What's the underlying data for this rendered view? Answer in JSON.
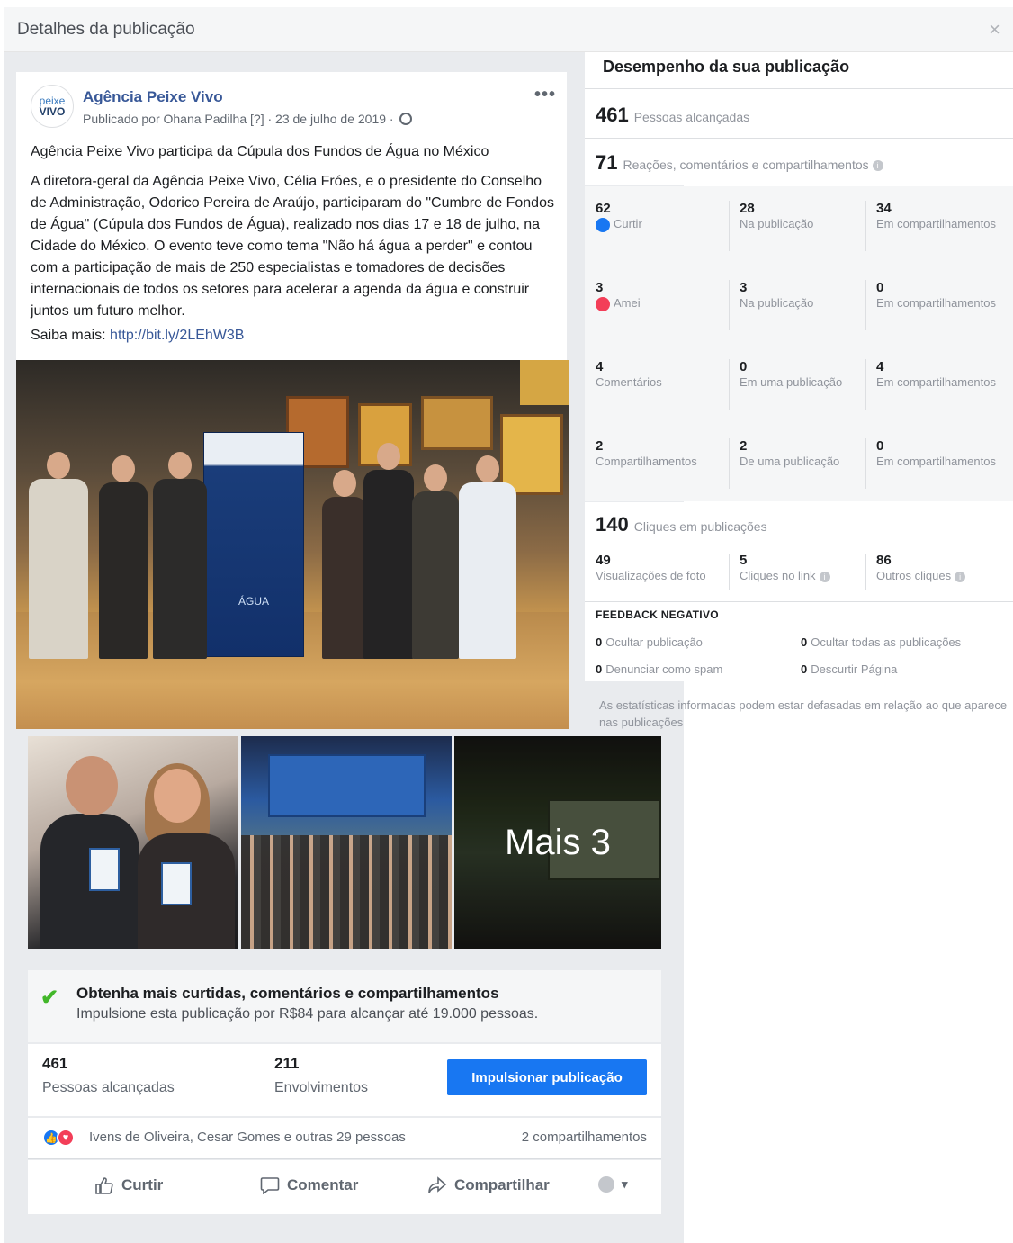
{
  "dialog": {
    "title": "Detalhes da publicação",
    "close": "×"
  },
  "post": {
    "page_name": "Agência Peixe Vivo",
    "logo_line1": "peixe",
    "logo_line2": "VIVO",
    "meta": "Publicado por Ohana Padilha [?] · 23 de julho de 2019 ·",
    "more": "•••",
    "headline": "Agência Peixe Vivo participa da Cúpula dos Fundos de Água no México",
    "body": "A diretora-geral da Agência Peixe Vivo, Célia Fróes, e o presidente do Conselho de Administração, Odorico Pereira de Araújo, participaram do \"Cumbre de Fondos de Água\" (Cúpula dos Fundos de Água), realizado nos dias 17 e 18 de julho, na Cidade do México. O evento teve como tema \"Não há água a perder\" e contou com a participação de mais de 250 especialistas e tomadores de decisões internacionais de todos os setores para acelerar a agenda da água e construir juntos um futuro melhor.",
    "link_prefix": "Saiba mais:",
    "link": "http://bit.ly/2LEhW3B",
    "banner_word": "ÁGUA",
    "more_photos": "Mais 3"
  },
  "boost": {
    "title": "Obtenha mais curtidas, comentários e compartilhamentos",
    "subtitle": "Impulsione esta publicação por R$84 para alcançar até 19.000 pessoas."
  },
  "summary": {
    "reach_value": "461",
    "reach_label": "Pessoas alcançadas",
    "engagement_value": "211",
    "engagement_label": "Envolvimentos",
    "boost_button": "Impulsionar publicação"
  },
  "reactions": {
    "names": "Ivens de Oliveira, Cesar Gomes e outras 29 pessoas",
    "shares": "2 compartilhamentos"
  },
  "actions": {
    "like": "Curtir",
    "comment": "Comentar",
    "share": "Compartilhar"
  },
  "performance": {
    "title": "Desempenho da sua publicação",
    "reach_value": "461",
    "reach_label": "Pessoas alcançadas",
    "reactions_value": "71",
    "reactions_label": "Reações, comentários e compartilhamentos",
    "rows": [
      {
        "total": "62",
        "total_label": "Curtir",
        "on_post": "28",
        "on_post_label": "Na publicação",
        "on_shares": "34",
        "on_shares_label": "Em compartilhamentos"
      },
      {
        "total": "3",
        "total_label": "Amei",
        "on_post": "3",
        "on_post_label": "Na publicação",
        "on_shares": "0",
        "on_shares_label": "Em compartilhamentos"
      },
      {
        "total": "4",
        "total_label": "Comentários",
        "on_post": "0",
        "on_post_label": "Em uma publicação",
        "on_shares": "4",
        "on_shares_label": "Em compartilhamentos"
      },
      {
        "total": "2",
        "total_label": "Compartilhamentos",
        "on_post": "2",
        "on_post_label": "De uma publicação",
        "on_shares": "0",
        "on_shares_label": "Em compartilhamentos"
      }
    ],
    "clicks_value": "140",
    "clicks_label": "Cliques em publicações",
    "clicks": [
      {
        "value": "49",
        "label": "Visualizações de foto"
      },
      {
        "value": "5",
        "label": "Cliques no link"
      },
      {
        "value": "86",
        "label": "Outros cliques"
      }
    ],
    "negative_title": "FEEDBACK NEGATIVO",
    "negative": [
      {
        "value": "0",
        "label": "Ocultar publicação"
      },
      {
        "value": "0",
        "label": "Ocultar todas as publicações"
      },
      {
        "value": "0",
        "label": "Denunciar como spam"
      },
      {
        "value": "0",
        "label": "Descurtir Página"
      }
    ],
    "disclaimer": "As estatísticas informadas podem estar defasadas em relação ao que aparece nas publicações"
  }
}
